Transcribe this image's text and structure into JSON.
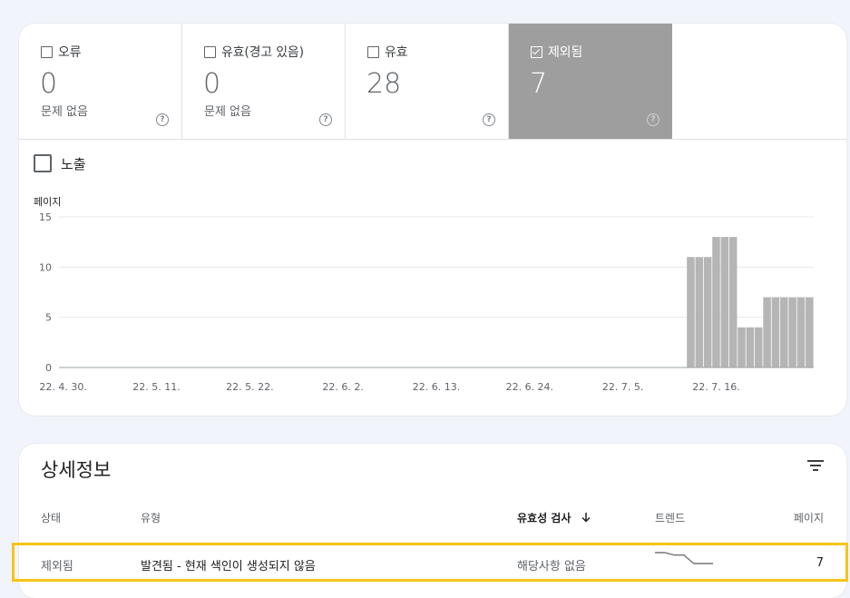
{
  "tiles": [
    {
      "label": "오류",
      "value": "0",
      "sub": "문제 없음",
      "checked": false
    },
    {
      "label": "유효(경고 있음)",
      "value": "0",
      "sub": "문제 없음",
      "checked": false
    },
    {
      "label": "유효",
      "value": "28",
      "sub": "",
      "checked": false
    },
    {
      "label": "제외됨",
      "value": "7",
      "sub": "",
      "checked": true
    }
  ],
  "impressions_label": "노출",
  "chart_data": {
    "type": "bar",
    "ylabel": "페이지",
    "ylim": [
      0,
      15
    ],
    "yticks": [
      0,
      5,
      10,
      15
    ],
    "xticks": [
      "22. 4. 30.",
      "22. 5. 11.",
      "22. 5. 22.",
      "22. 6. 2.",
      "22. 6. 13.",
      "22. 6. 24.",
      "22. 7. 5.",
      "22. 7. 16."
    ],
    "series": [
      {
        "values": [
          0,
          0,
          0,
          0,
          0,
          0,
          0,
          0,
          0,
          0,
          0,
          0,
          0,
          0,
          0,
          0,
          0,
          0,
          0,
          0,
          0,
          0,
          0,
          0,
          0,
          0,
          0,
          0,
          0,
          0,
          0,
          0,
          0,
          0,
          0,
          0,
          0,
          0,
          0,
          0,
          0,
          0,
          0,
          0,
          0,
          0,
          0,
          0,
          0,
          0,
          0,
          0,
          0,
          0,
          0,
          0,
          0,
          0,
          0,
          0,
          0,
          0,
          0,
          0,
          0,
          0,
          0,
          0,
          0,
          0,
          0,
          0,
          0,
          0,
          11,
          11,
          11,
          13,
          13,
          13,
          4,
          4,
          4,
          7,
          7,
          7,
          7,
          7,
          7
        ]
      }
    ],
    "bar_color": "#b5b5b5"
  },
  "details": {
    "title": "상세정보",
    "columns": {
      "status": "상태",
      "type": "유형",
      "validation": "유효성 검사",
      "trend": "트렌드",
      "pages": "페이지"
    },
    "rows": [
      {
        "status": "제외됨",
        "type": "발견됨 - 현재 색인이 생성되지 않음",
        "validation": "해당사항 없음",
        "trend": [
          13,
          13,
          11,
          11,
          4,
          4,
          4
        ],
        "pages": "7"
      }
    ]
  },
  "colors": {
    "selected_tile": "#9e9e9e",
    "highlight": "#f5c518",
    "background": "#f1f4fb"
  }
}
